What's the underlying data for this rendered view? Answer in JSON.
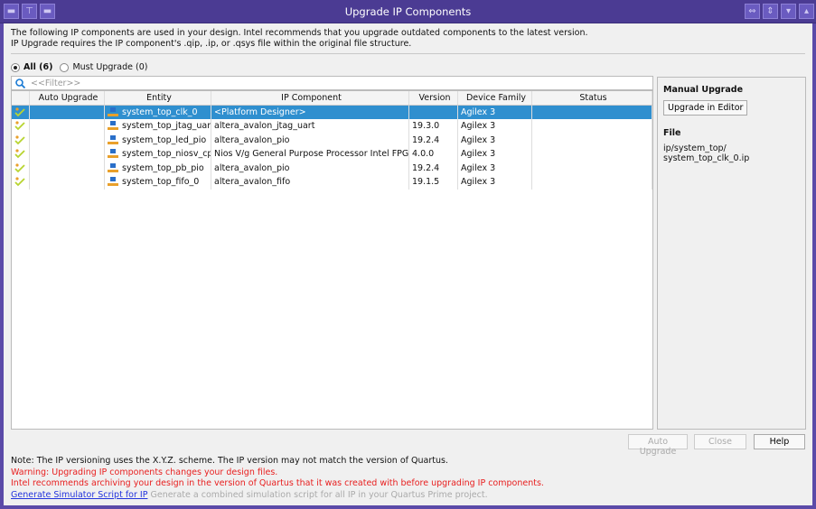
{
  "window": {
    "title": "Upgrade IP Components"
  },
  "intro": {
    "line1": "The following IP components are used in your design. Intel recommends that you upgrade outdated components to the latest version.",
    "line2": "IP Upgrade requires the IP component's .qip, .ip, or .qsys file within the original file structure."
  },
  "filters": {
    "all": "All (6)",
    "must": "Must Upgrade (0)",
    "selected": "all",
    "placeholder": "<<Filter>>"
  },
  "table": {
    "headers": [
      "",
      "Auto Upgrade",
      "Entity",
      "IP Component",
      "Version",
      "Device Family",
      "Status"
    ],
    "rows": [
      {
        "entity": "system_top_clk_0",
        "component": "<Platform Designer>",
        "version": "",
        "family": "Agilex 3",
        "status": ""
      },
      {
        "entity": "system_top_jtag_uart",
        "component": "altera_avalon_jtag_uart",
        "version": "19.3.0",
        "family": "Agilex 3",
        "status": ""
      },
      {
        "entity": "system_top_led_pio",
        "component": "altera_avalon_pio",
        "version": "19.2.4",
        "family": "Agilex 3",
        "status": ""
      },
      {
        "entity": "system_top_niosv_cpu",
        "component": "Nios V/g General Purpose Processor Intel FPGA IP",
        "version": "4.0.0",
        "family": "Agilex 3",
        "status": ""
      },
      {
        "entity": "system_top_pb_pio",
        "component": "altera_avalon_pio",
        "version": "19.2.4",
        "family": "Agilex 3",
        "status": ""
      },
      {
        "entity": "system_top_fifo_0",
        "component": "altera_avalon_fifo",
        "version": "19.1.5",
        "family": "Agilex 3",
        "status": ""
      }
    ]
  },
  "panel": {
    "manual_title": "Manual Upgrade",
    "upgrade_btn": "Upgrade in Editor",
    "file_title": "File",
    "file_path1": "ip/system_top/",
    "file_path2": "system_top_clk_0.ip"
  },
  "buttons": {
    "auto": "Auto Upgrade",
    "close": "Close",
    "help": "Help"
  },
  "notes": {
    "note": "Note: The IP versioning uses the X.Y.Z. scheme. The IP version may not match the version of Quartus.",
    "warning": "Warning: Upgrading IP components changes your design files.",
    "recommend": "Intel recommends archiving your design in the version of Quartus that it was created with before upgrading IP components.",
    "link": "Generate Simulator Script for IP",
    "link_desc": "Generate a combined simulation script for all IP in your Quartus Prime project."
  }
}
